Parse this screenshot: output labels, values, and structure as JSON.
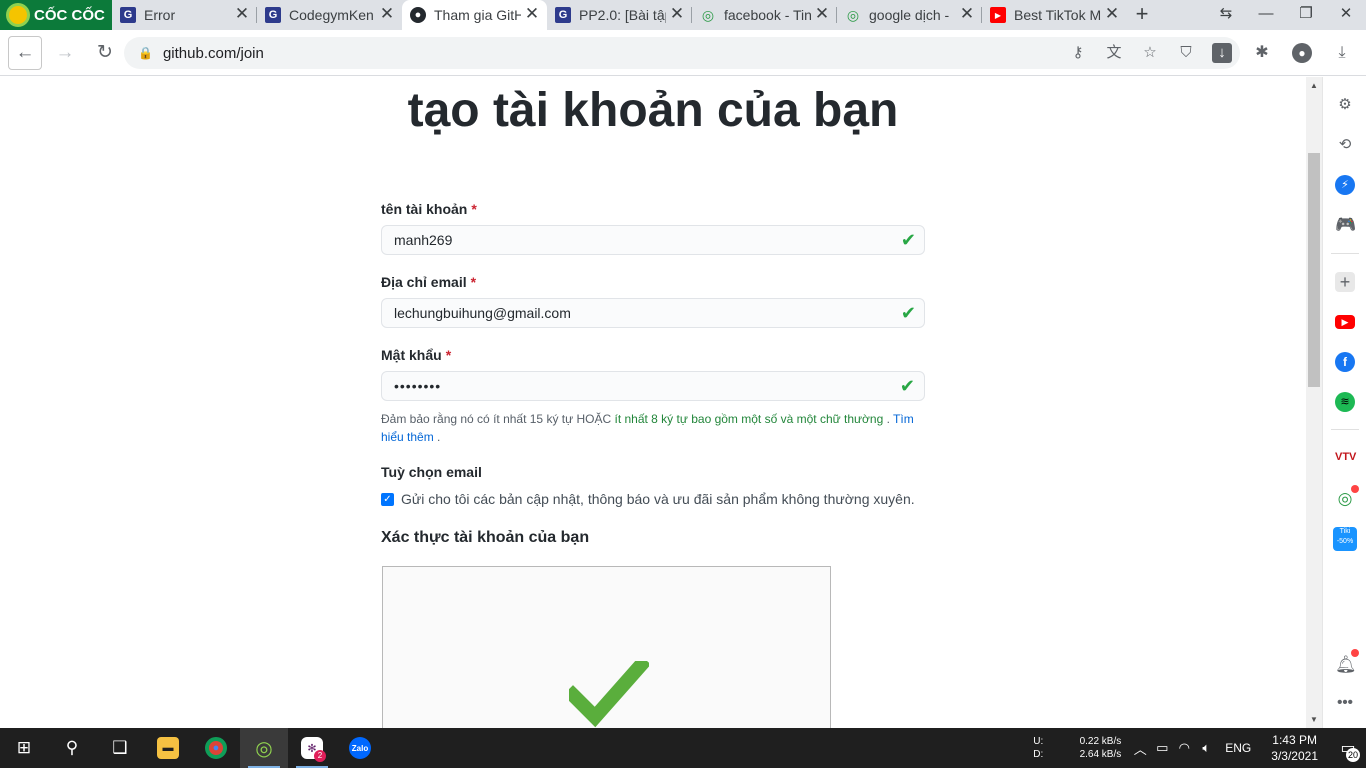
{
  "browser": {
    "brand_name": "CỐC CỐC",
    "tabs": [
      {
        "title": "Error",
        "favicon": "codegym-icon"
      },
      {
        "title": "CodegymKen",
        "favicon": "codegym-icon"
      },
      {
        "title": "Tham gia GitH",
        "favicon": "github-icon"
      },
      {
        "title": "PP2.0: [Bài tập",
        "favicon": "codegym-icon"
      },
      {
        "title": "facebook - Tin",
        "favicon": "coccoc-icon"
      },
      {
        "title": "google dịch -",
        "favicon": "coccoc-icon"
      },
      {
        "title": "Best TikTok M",
        "favicon": "youtube-icon"
      }
    ],
    "url": "github.com/join"
  },
  "page": {
    "heading": "tạo tài khoản của bạn",
    "username": {
      "label": "tên tài khoản",
      "required_mark": "*",
      "value": "manh269"
    },
    "email": {
      "label": "Địa chỉ email",
      "required_mark": "*",
      "value": "lechungbuihung@gmail.com"
    },
    "password": {
      "label": "Mật khẩu",
      "required_mark": "*",
      "value": "••••••••"
    },
    "password_note": {
      "part1": "Đảm bảo rằng nó có ít nhất 15 ký tự HOẶC ",
      "part2": "ít nhất 8 ký tự bao gồm một số và một chữ thường",
      "part3": " . ",
      "link": "Tìm hiểu thêm",
      "part4": " ."
    },
    "email_prefs": {
      "heading": "Tuỳ chọn email",
      "checkbox_label": "Gửi cho tôi các bản cập nhật, thông báo và ưu đãi sản phẩm không thường xuyên.",
      "checked": true
    },
    "verify_heading": "Xác thực tài khoản của bạn"
  },
  "taskbar": {
    "net_up_label": "U:",
    "net_up": "0.22 kB/s",
    "net_down_label": "D:",
    "net_down": "2.64 kB/s",
    "lang": "ENG",
    "time": "1:43 PM",
    "date": "3/3/2021",
    "notifications": "20",
    "slack_badge": "2"
  },
  "colors": {
    "success": "#28a745",
    "link": "#0366d6",
    "required": "#cb2431"
  }
}
